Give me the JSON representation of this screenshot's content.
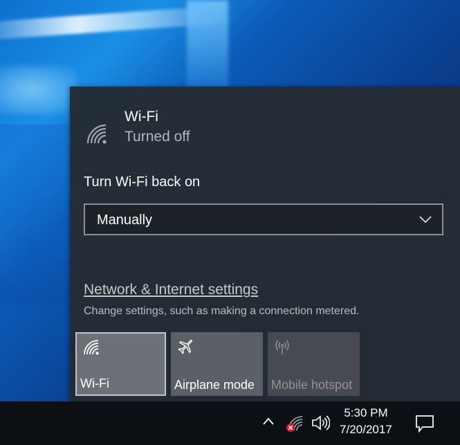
{
  "wifi_panel": {
    "title": "Wi-Fi",
    "state": "Turned off",
    "turn_on_label": "Turn Wi-Fi back on",
    "turn_on_value": "Manually",
    "settings_link": "Network & Internet settings",
    "settings_description": "Change settings, such as making a connection metered."
  },
  "quick_actions": [
    {
      "label": "Wi-Fi",
      "icon": "wifi-icon",
      "active": true
    },
    {
      "label": "Airplane mode",
      "icon": "airplane-icon",
      "active": false
    },
    {
      "label": "Mobile hotspot",
      "icon": "hotspot-icon",
      "active": false,
      "disabled": true
    }
  ],
  "taskbar": {
    "time": "5:30 PM",
    "date": "7/20/2017",
    "icons": [
      "chevron-up-icon",
      "network-disconnected-icon",
      "volume-icon",
      "action-center-icon"
    ]
  },
  "colors": {
    "flyout_bg": "#252b34",
    "tile_active": "#6d7177",
    "taskbar_bg": "#0c0f14",
    "alert_red": "#e81123"
  }
}
